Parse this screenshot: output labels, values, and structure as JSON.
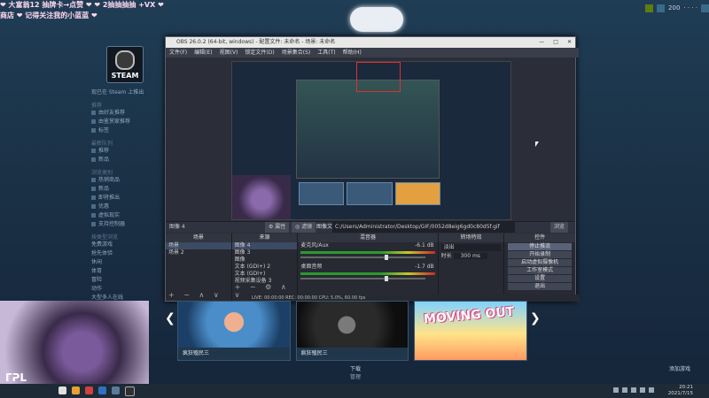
{
  "marquee": {
    "line1": "❤ 大富翁12 抽牌卡→点赞 ❤ ❤ 2抽抽抽抽 +VX ❤",
    "line2": "商店  ❤ 记得关注我的小蓝蓝 ❤"
  },
  "nav": {
    "back": "←",
    "forward": "→",
    "store": "商店"
  },
  "topright": {
    "points": "200",
    "user": "· · · ·"
  },
  "steam": {
    "logo": "STEAM",
    "status": "现已在 Steam 上推出",
    "sections": [
      {
        "title": "推荐",
        "items": [
          "由好友推荐",
          "由鉴赏家推荐",
          "标签"
        ]
      },
      {
        "title": "最新队列",
        "items": [
          "推荐",
          "新品"
        ]
      },
      {
        "title": "浏览类别",
        "items": [
          "热销商品",
          "新品",
          "即将推出",
          "优惠",
          "虚拟现实",
          "支持控制器"
        ]
      },
      {
        "title": "按类型浏览",
        "items": [
          "免费游戏",
          "抢先体验",
          "休闲",
          "体育",
          "冒险",
          "动作",
          "大型多人在线"
        ]
      }
    ]
  },
  "obs": {
    "title": "OBS 26.0.2 (64-bit, windows) - 配置文件: 未命名 - 场景: 未命名",
    "controls": [
      "—",
      "□",
      "✕"
    ],
    "menu": [
      "文件(F)",
      "编辑(E)",
      "视图(V)",
      "锁定文件(D)",
      "场景集合(S)",
      "工具(T)",
      "帮助(H)"
    ],
    "source_label": "图像 4",
    "prop_btn": "⚙ 属性",
    "filter_btn": "◎ 滤镜",
    "file_label": "图像文件",
    "file_path": "C:/Users/Administrator/Desktop/GIF/0052d8eig6gd0c80d5f.gif",
    "browse": "浏览",
    "docks": {
      "scenes": {
        "title": "场景",
        "items": [
          "场景",
          "场景 2"
        ]
      },
      "sources": {
        "title": "来源",
        "items": [
          "图像 4",
          "图像 3",
          "图像",
          "文本 (GDI+) 2",
          "文本 (GDI+)",
          "视频采集设备 3"
        ]
      },
      "mixer": {
        "title": "混音器",
        "tracks": [
          {
            "name": "麦克风/Aux",
            "level": "-6.1 dB"
          },
          {
            "name": "桌面音频",
            "level": "-1.7 dB"
          }
        ]
      },
      "transitions": {
        "title": "转场特效",
        "type": "淡出",
        "duration_label": "时长",
        "duration": "300 ms"
      },
      "controls": {
        "title": "控件",
        "buttons": [
          "停止推流",
          "开始录制",
          "启动虚拟摄像机",
          "工作室模式",
          "设置",
          "退出"
        ]
      }
    },
    "status": "LIVE: 00:00:00   REC: 00:00:00   CPU: 5.0%, 60.00 fps"
  },
  "carousel": {
    "cards": [
      {
        "caption": "疯狂殖民三",
        "kind": "a"
      },
      {
        "caption": "疯狂殖民三",
        "kind": "b"
      },
      {
        "caption": "",
        "title": "MOVING OUT",
        "kind": "c"
      }
    ],
    "see_more_line1": "下载",
    "see_more_line2": "管理"
  },
  "webcam_watermark": "ᒥᕈᒪ",
  "add_game": "添加游戏",
  "taskbar": {
    "time": "20:21",
    "date": "2021/7/15"
  },
  "colors": {
    "accent": "#66c0f4",
    "obs_bg": "#2b2e38",
    "steam_bg": "#1b2838"
  }
}
